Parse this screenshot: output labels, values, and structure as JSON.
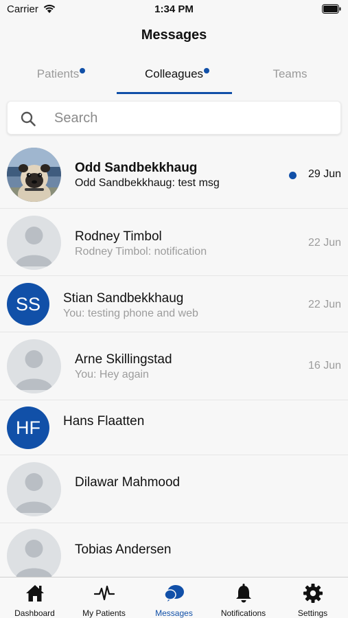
{
  "status_bar": {
    "carrier": "Carrier",
    "time": "1:34 PM"
  },
  "header": {
    "title": "Messages"
  },
  "tabs": [
    {
      "label": "Patients",
      "has_dot": true,
      "active": false
    },
    {
      "label": "Colleagues",
      "has_dot": true,
      "active": true
    },
    {
      "label": "Teams",
      "has_dot": false,
      "active": false
    }
  ],
  "search": {
    "placeholder": "Search",
    "value": ""
  },
  "conversations": [
    {
      "name": "Odd Sandbekkhaug",
      "preview": "Odd Sandbekkhaug: test msg",
      "date": "29 Jun",
      "unread": true,
      "avatar": "photo-pug"
    },
    {
      "name": "Rodney Timbol",
      "preview": "Rodney Timbol: notification",
      "date": "22 Jun",
      "unread": false,
      "avatar": "placeholder"
    },
    {
      "name": "Stian Sandbekkhaug",
      "preview": "You: testing phone and web",
      "date": "22 Jun",
      "unread": false,
      "avatar": "initials",
      "initials": "SS"
    },
    {
      "name": "Arne Skillingstad",
      "preview": "You: Hey again",
      "date": "16 Jun",
      "unread": false,
      "avatar": "placeholder"
    },
    {
      "name": "Hans Flaatten",
      "preview": "",
      "date": "",
      "unread": false,
      "avatar": "initials",
      "initials": "HF"
    },
    {
      "name": "Dilawar Mahmood",
      "preview": "",
      "date": "",
      "unread": false,
      "avatar": "placeholder"
    },
    {
      "name": "Tobias Andersen",
      "preview": "",
      "date": "",
      "unread": false,
      "avatar": "placeholder"
    }
  ],
  "tab_bar": [
    {
      "label": "Dashboard",
      "icon": "home-icon",
      "active": false
    },
    {
      "label": "My Patients",
      "icon": "heartbeat-icon",
      "active": false
    },
    {
      "label": "Messages",
      "icon": "chat-bubbles-icon",
      "active": true
    },
    {
      "label": "Notifications",
      "icon": "bell-icon",
      "active": false
    },
    {
      "label": "Settings",
      "icon": "gear-icon",
      "active": false
    }
  ],
  "colors": {
    "accent": "#1150a8",
    "muted_text": "#9c9c9c",
    "background": "#f7f7f7"
  }
}
